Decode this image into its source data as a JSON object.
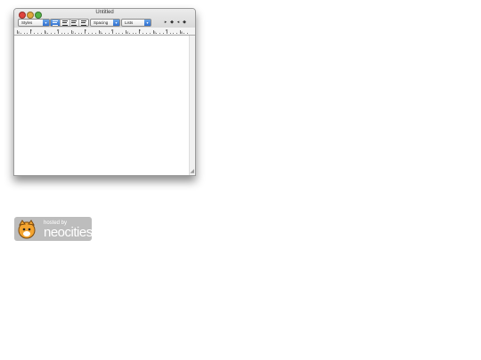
{
  "window": {
    "title": "Untitled",
    "toolbar": {
      "styles_label": "Styles",
      "spacing_label": "Spacing",
      "lists_label": "Lists",
      "popup_arrow": "▾",
      "tab_glyphs": [
        "▸",
        "◆",
        "◂",
        "◆"
      ]
    },
    "ruler": {
      "numbers": [
        "0",
        "1",
        "2",
        "3",
        "4",
        "5",
        "6"
      ]
    },
    "document_text": ""
  },
  "badge": {
    "hosted_by": "hosted by",
    "brand": "neocities"
  },
  "colors": {
    "accent": "#2f6fd0",
    "badge_bg": "#bdbdbd"
  }
}
